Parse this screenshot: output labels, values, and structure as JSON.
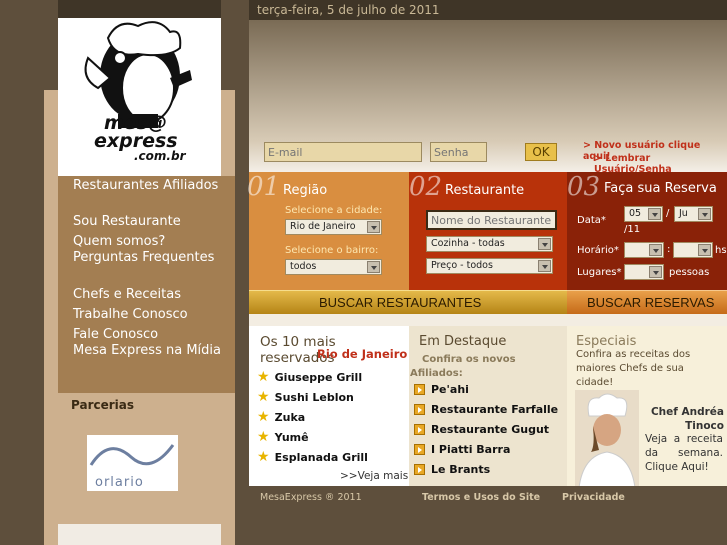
{
  "date": "terça-feira, 5 de julho de 2011",
  "logo": {
    "line1": "mes@",
    "line2": "express",
    "line3": ".com.br"
  },
  "nav": {
    "items": [
      "Restaurantes Afiliados",
      "Sou Restaurante",
      "Quem somos?",
      "Perguntas Frequentes",
      "Chefs e Receitas",
      "Trabalhe Conosco",
      "Fale Conosco",
      "Mesa Express na Mídia"
    ],
    "partners_label": "Parcerias",
    "partner_logo_text": "orlario"
  },
  "login": {
    "email_placeholder": "E-mail",
    "password_placeholder": "Senha",
    "ok_label": "OK",
    "new_user": "> Novo usuário clique aqui!",
    "remember": "> Lembrar Usuário/Senha"
  },
  "search": {
    "region": {
      "num": "01",
      "title": "Região",
      "city_label": "Selecione a cidade:",
      "city_value": "Rio de Janeiro",
      "district_label": "Selecione o bairro:",
      "district_value": "todos"
    },
    "restaurant": {
      "num": "02",
      "title": "Restaurante",
      "name_placeholder": "Nome do Restaurante",
      "cuisine_value": "Cozinha - todas",
      "price_value": "Preço - todos"
    },
    "reservation": {
      "num": "03",
      "title": "Faça sua Reserva",
      "date_label": "Data*",
      "day_value": "05",
      "sep": "/",
      "month_value": "Ju",
      "year_text": "/11",
      "time_label": "Horário*",
      "hour_sep": ":",
      "hs_text": "hs",
      "seats_label": "Lugares*",
      "people_text": "pessoas"
    },
    "search_restaurants_label": "BUSCAR RESTAURANTES",
    "search_reservations_label": "BUSCAR RESERVAS"
  },
  "top10": {
    "title": "Os 10 mais reservados",
    "city": "Rio de Janeiro",
    "items": [
      "Giuseppe Grill",
      "Sushi Leblon",
      "Zuka",
      "Yumê",
      "Esplanada Grill"
    ],
    "more": ">>Veja mais"
  },
  "featured": {
    "title": "Em Destaque",
    "subtitle": "Confira os novos Afiliados:",
    "items": [
      "Pe'ahi",
      "Restaurante Farfalle",
      "Restaurante Gugut",
      "I Piatti Barra",
      "Le Brants"
    ]
  },
  "specials": {
    "title": "Especiais",
    "text": "Confira as receitas dos maiores Chefs de sua cidade!",
    "chef_name": "Chef Andréa Tinoco",
    "chef_text": "Veja a receita da semana. Clique Aqui!"
  },
  "footer": {
    "copyright": "MesaExpress ® 2011",
    "terms": "Termos e Usos do Site",
    "privacy": "Privacidade"
  }
}
